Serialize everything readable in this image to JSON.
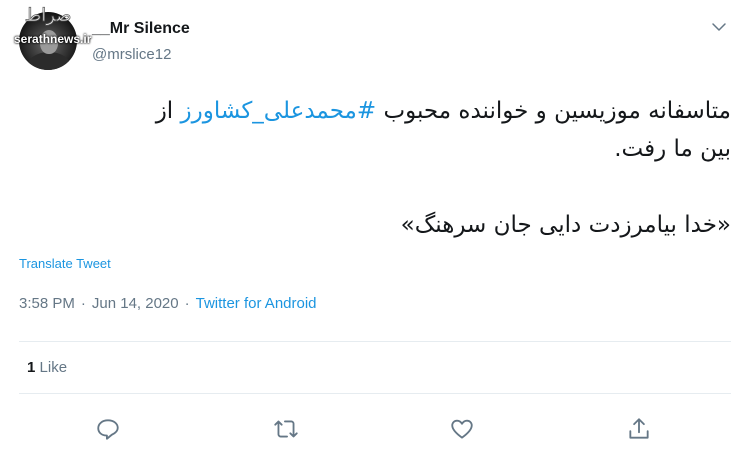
{
  "watermark": {
    "logo_text": "صراط",
    "site_text": "serathnews.ir"
  },
  "author": {
    "name_prefix": "__",
    "name": "Mr Silence",
    "handle": "@mrslice12"
  },
  "tweet": {
    "line1_before": "متاسفانه موزیسین و خواننده محبوب ",
    "hashtag": "#محمدعلی_کشاورز",
    "line1_after": " از",
    "line2": "بین ما رفت.",
    "line3": "«خدا بیامرزدت دایی جان سرهنگ»"
  },
  "translate_label": "Translate Tweet",
  "meta": {
    "time": "3:58 PM",
    "sep1": "·",
    "date": "Jun 14, 2020",
    "sep2": "·",
    "source": "Twitter for Android"
  },
  "stats": {
    "likes_count": "1",
    "likes_label": "Like"
  },
  "actions": {
    "reply": "reply-icon",
    "retweet": "retweet-icon",
    "like": "heart-icon",
    "share": "share-icon"
  },
  "colors": {
    "link": "#1b95e0",
    "muted": "#657786",
    "text": "#14171a",
    "divider": "#e6ecf0"
  }
}
